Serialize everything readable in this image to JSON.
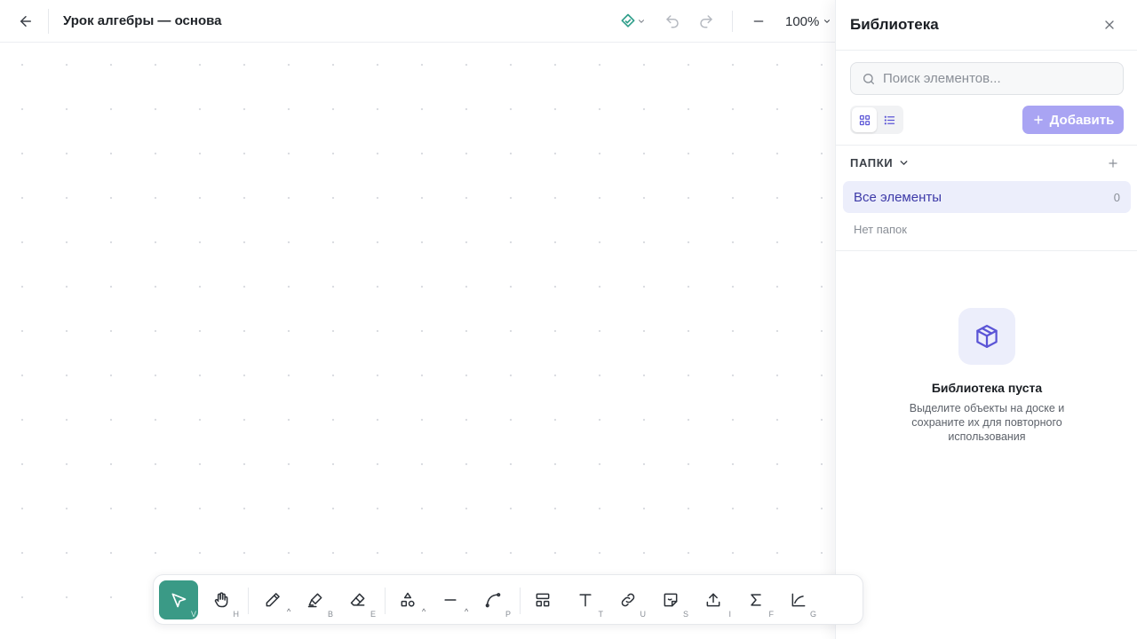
{
  "header": {
    "title": "Урок алгебры — основа",
    "zoom": "100%"
  },
  "panel": {
    "title": "Библиотека",
    "search_placeholder": "Поиск элементов...",
    "add_label": "Добавить",
    "folders_label": "ПАПКИ",
    "all_items_label": "Все элементы",
    "all_items_count": "0",
    "no_folders": "Нет папок",
    "empty_title": "Библиотека пуста",
    "empty_desc": "Выделите объекты на доске и сохраните их для повторного использования"
  },
  "toolbar": {
    "tools": [
      {
        "name": "select",
        "key": "V"
      },
      {
        "name": "hand",
        "key": "H"
      },
      {
        "name": "pen",
        "key": ""
      },
      {
        "name": "highlighter",
        "key": "B"
      },
      {
        "name": "eraser",
        "key": "E"
      },
      {
        "name": "shapes",
        "key": ""
      },
      {
        "name": "line",
        "key": ""
      },
      {
        "name": "curve",
        "key": "P"
      },
      {
        "name": "frame",
        "key": ""
      },
      {
        "name": "text",
        "key": "T"
      },
      {
        "name": "link",
        "key": "U"
      },
      {
        "name": "sticky",
        "key": "S"
      },
      {
        "name": "upload",
        "key": "I"
      },
      {
        "name": "formula",
        "key": "F"
      },
      {
        "name": "graph",
        "key": "G"
      }
    ],
    "caret": "^"
  },
  "colors": {
    "accent": "#3a9a86",
    "panel_accent": "#5b55d6",
    "add_button": "#a9a4f3"
  }
}
